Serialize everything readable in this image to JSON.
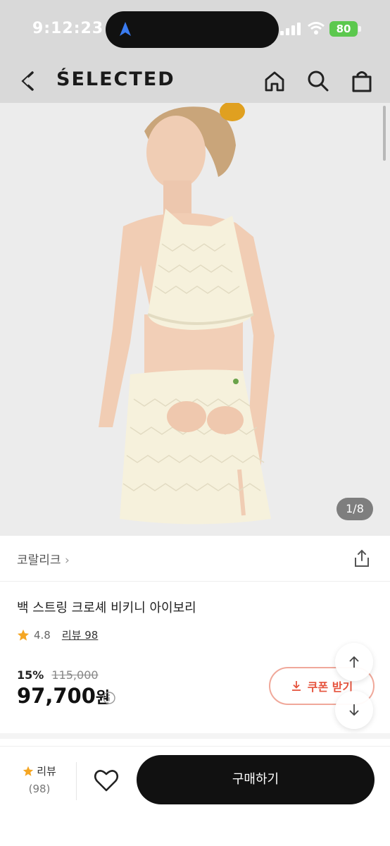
{
  "status_bar": {
    "time": "9:12:23",
    "battery": "80"
  },
  "header": {
    "brand": "ŚELECTED"
  },
  "gallery": {
    "counter": "1/8"
  },
  "product": {
    "brand_name": "코랄리크",
    "title": "백 스트링 크로셰 비키니 아이보리",
    "rating": "4.8",
    "review_link": "리뷰 98",
    "discount": "15%",
    "original_price": "115,000",
    "price": "97,700",
    "currency": "원"
  },
  "coupon": {
    "label": "쿠폰 받기"
  },
  "bottom_bar": {
    "review_label": "리뷰",
    "review_count": "(98)",
    "buy_label": "구매하기"
  },
  "colors": {
    "accent": "#e5533d",
    "buy_button": "#111111",
    "star": "#f5a623",
    "battery": "#5cc84e"
  }
}
